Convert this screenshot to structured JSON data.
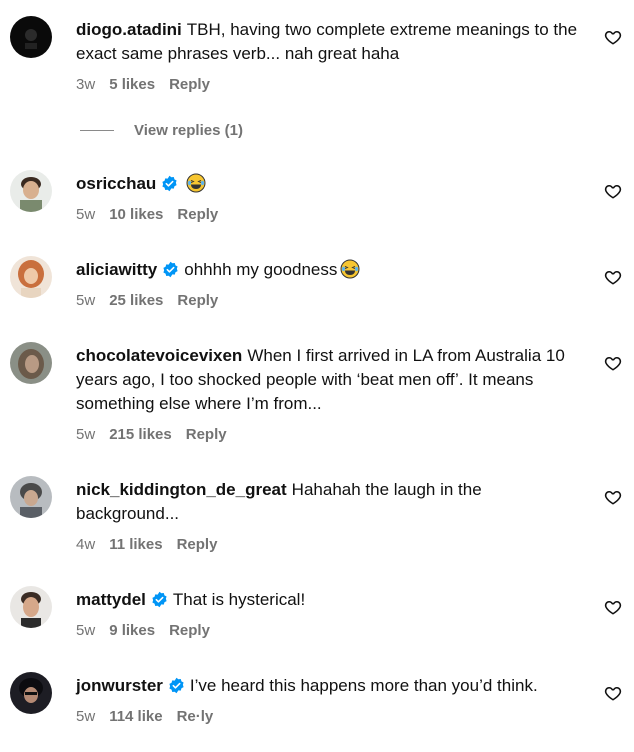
{
  "comments": [
    {
      "username": "diogo.atadini",
      "verified": false,
      "text": "TBH, having two complete extreme meanings to the exact same phrases verb... nah great haha",
      "age": "3w",
      "likes": "5 likes",
      "reply": "Reply"
    },
    {
      "username": "osricchau",
      "verified": true,
      "text": "",
      "emoji": "laughing-emoji",
      "age": "5w",
      "likes": "10 likes",
      "reply": "Reply"
    },
    {
      "username": "aliciawitty",
      "verified": true,
      "text": "ohhhh my goodness",
      "emoji": "laughing-emoji",
      "age": "5w",
      "likes": "25 likes",
      "reply": "Reply"
    },
    {
      "username": "chocolatevoicevixen",
      "verified": false,
      "text": "When I first arrived in LA from Australia 10 years ago, I too shocked people with ‘beat men off’. It means something else where I’m from...",
      "age": "5w",
      "likes": "215 likes",
      "reply": "Reply"
    },
    {
      "username": "nick_kiddington_de_great",
      "verified": false,
      "text": "Hahahah the laugh in the background...",
      "age": "4w",
      "likes": "11 likes",
      "reply": "Reply"
    },
    {
      "username": "mattydel",
      "verified": true,
      "text": "That is hysterical!",
      "age": "5w",
      "likes": "9 likes",
      "reply": "Reply"
    },
    {
      "username": "jonwurster",
      "verified": true,
      "text": "I’ve heard this happens more than you’d think.",
      "age": "5w",
      "likes": "114 like",
      "reply": "Re·ly"
    }
  ],
  "view_replies": "View replies (1)",
  "colors": {
    "verified": "#0095f6",
    "muted": "#737373",
    "text": "#111111"
  }
}
